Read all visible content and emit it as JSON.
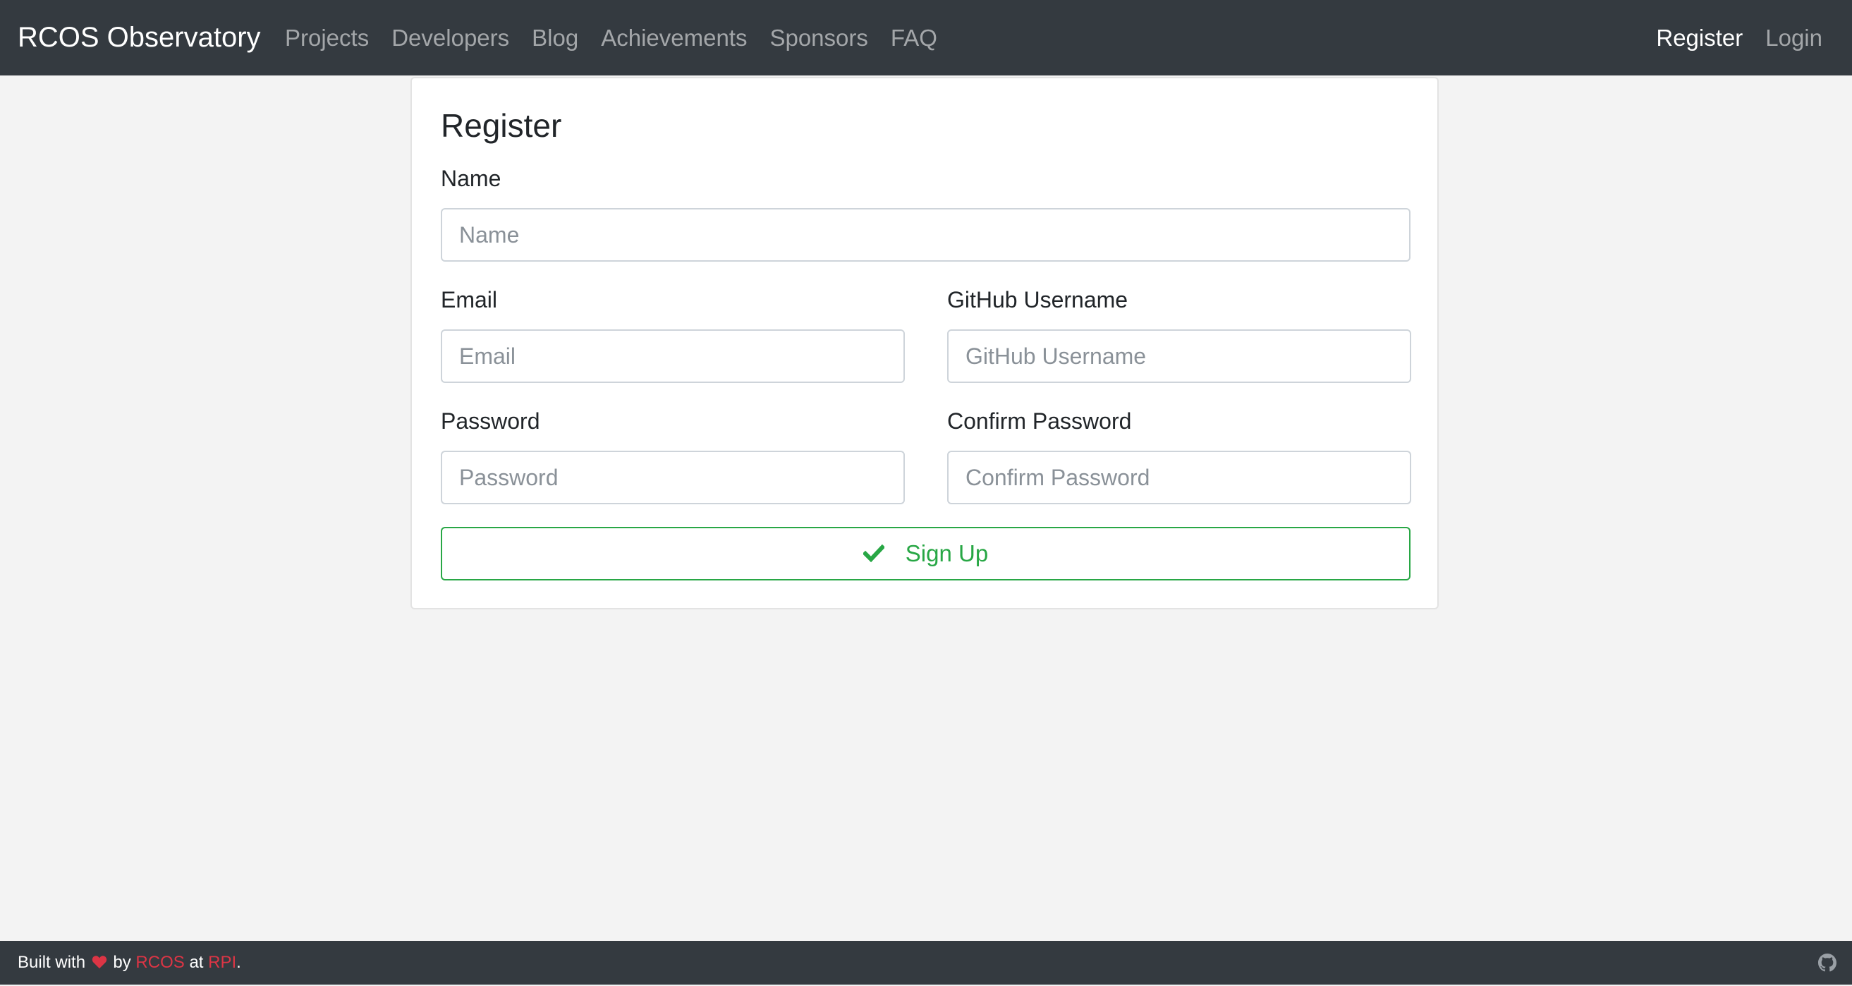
{
  "navbar": {
    "brand": "RCOS Observatory",
    "links": [
      {
        "label": "Projects"
      },
      {
        "label": "Developers"
      },
      {
        "label": "Blog"
      },
      {
        "label": "Achievements"
      },
      {
        "label": "Sponsors"
      },
      {
        "label": "FAQ"
      }
    ],
    "right_links": [
      {
        "label": "Register",
        "active": true
      },
      {
        "label": "Login",
        "active": false
      }
    ]
  },
  "form": {
    "title": "Register",
    "name": {
      "label": "Name",
      "placeholder": "Name",
      "value": ""
    },
    "email": {
      "label": "Email",
      "placeholder": "Email",
      "value": ""
    },
    "github": {
      "label": "GitHub Username",
      "placeholder": "GitHub Username",
      "value": ""
    },
    "password": {
      "label": "Password",
      "placeholder": "Password",
      "value": ""
    },
    "confirm": {
      "label": "Confirm Password",
      "placeholder": "Confirm Password",
      "value": ""
    },
    "submit": {
      "label": "Sign Up",
      "icon": "check-icon"
    }
  },
  "footer": {
    "built_with": "Built with",
    "heart_icon": "heart-icon",
    "by": "by",
    "rcos": "RCOS",
    "at": "at",
    "rpi": "RPI",
    "period": ".",
    "github_icon": "github-icon"
  },
  "colors": {
    "navbar_bg": "#343a40",
    "page_bg": "#f3f3f3",
    "success": "#28a745",
    "danger": "#dc3545"
  }
}
